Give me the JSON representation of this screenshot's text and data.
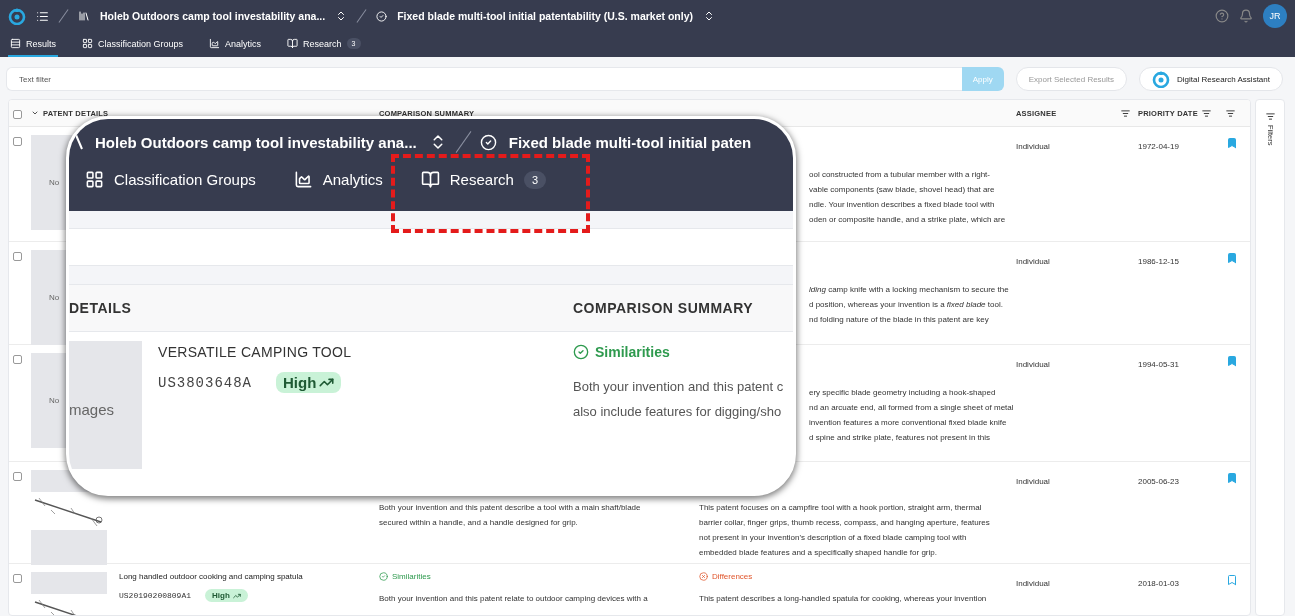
{
  "topbar": {
    "project": "Holeb Outdoors camp tool investability ana...",
    "search": "Fixed blade multi-tool initial patentability (U.S. market only)",
    "avatar": "JR"
  },
  "tabs": [
    {
      "label": "Results",
      "selected": true
    },
    {
      "label": "Classification Groups",
      "selected": false
    },
    {
      "label": "Analytics",
      "selected": false
    },
    {
      "label": "Research",
      "selected": false,
      "count": "3"
    }
  ],
  "filter": {
    "placeholder": "Text filter",
    "apply": "Apply"
  },
  "select_all": {
    "checked": false
  },
  "actions": [
    {
      "label": "Export Selected Results",
      "disabled": true,
      "kind": "plain"
    },
    {
      "label": "Digital Research Assistant",
      "disabled": false,
      "kind": "assistant"
    }
  ],
  "table": {
    "columns": [
      "PATENT DETAILS",
      "COMPARISON SUMMARY",
      "ASSIGNEE",
      "PRIORITY DATE"
    ],
    "rows": [
      {
        "checked": false,
        "kind": "placeholder",
        "image_text": "No",
        "differences": {
          "text": "ool constructed from a tubular member with a right-\nvable components (saw blade, shovel head) that are\nndle. Your invention describes a fixed blade tool with\noden or composite handle, and a strike plate, which are"
        },
        "assignee": "Individual",
        "date": "1972-04-19",
        "bookmarked": true
      },
      {
        "checked": false,
        "kind": "placeholder",
        "image_text": "No",
        "differences": {
          "text": "*lding* camp knife with a locking mechanism to secure the\nd position, whereas your invention is a *fixed blade* tool.\nnd folding nature of the blade in this patent are key"
        },
        "assignee": "Individual",
        "date": "1986-12-15",
        "bookmarked": true
      },
      {
        "checked": false,
        "kind": "placeholder",
        "image_text": "No",
        "differences": {
          "text": "ery specific blade geometry including a hook-shaped\nnd an arcuate end, all formed from a single sheet of metal\ninvention features a more conventional fixed blade knife\nd spine and strike plate, features not present in this"
        },
        "assignee": "Individual",
        "date": "1994-05-31",
        "bookmarked": true
      },
      {
        "checked": false,
        "kind": "drawing",
        "similarities": {
          "text": "Both your invention and this patent describe a tool with a main shaft/blade\nsecured within a handle, and a handle designed for grip."
        },
        "differences": {
          "text": "This patent focuses on a campfire tool with a hook portion, straight arm, thermal\nbarrier collar, finger grips, thumb recess, compass, and hanging aperture, features\nnot present in your invention's description of a fixed blade camping tool with\nembedded blade features and a specifically shaped handle for grip."
        },
        "assignee": "Individual",
        "date": "2005-06-23",
        "bookmarked": true
      },
      {
        "checked": false,
        "kind": "drawing",
        "title": "Long handled outdoor cooking and camping spatula",
        "number": "US20190200809A1",
        "relevance": "High",
        "similarities": {
          "label": "Similarities",
          "text": "Both your invention and this patent relate to outdoor camping devices with a"
        },
        "differences": {
          "label": "Differences",
          "text": "This patent describes a long-handled spatula for cooking, whereas your invention"
        },
        "assignee": "Individual",
        "date": "2018-01-03",
        "bookmarked": false
      }
    ]
  },
  "filters_label": "Filters",
  "callout": {
    "project": "Holeb Outdoors camp tool investability ana...",
    "search": "Fixed blade multi-tool initial paten",
    "tabs": [
      {
        "label": "Classification Groups",
        "selected": false,
        "highlighted": false
      },
      {
        "label": "Analytics",
        "selected": false,
        "highlighted": false
      },
      {
        "label": "Research",
        "selected": false,
        "count": "3",
        "highlighted": true
      }
    ],
    "columns": [
      "DETAILS",
      "COMPARISON SUMMARY"
    ],
    "row": {
      "image_text": "mages",
      "title": "VERSATILE CAMPING TOOL",
      "number": "US3803648A",
      "relevance": "High",
      "similarities": {
        "label": "Similarities",
        "text": "Both your invention and this patent c\nalso include features for digging/sho"
      }
    }
  }
}
